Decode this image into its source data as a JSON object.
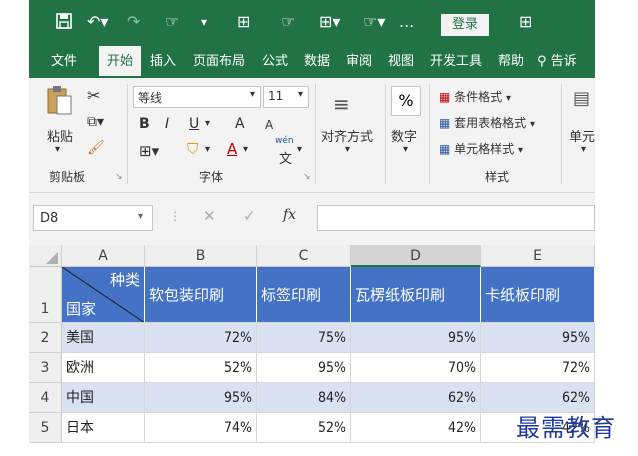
{
  "qat": {
    "save_icon": "save-icon",
    "undo_icon": "undo-icon",
    "redo_icon": "redo-icon",
    "more_label": "...",
    "login_label": "登录"
  },
  "tabs": [
    "文件",
    "开始",
    "插入",
    "页面布局",
    "公式",
    "数据",
    "审阅",
    "视图",
    "开发工具",
    "帮助",
    "告诉"
  ],
  "active_tab": "开始",
  "ribbon": {
    "clipboard": {
      "paste": "粘贴",
      "group": "剪贴板"
    },
    "font": {
      "name": "等线",
      "size": "11",
      "bold": "B",
      "italic": "I",
      "underline": "U",
      "grow": "A",
      "shrink": "A",
      "phonetic_top": "wén",
      "phonetic_bottom": "文",
      "color": "A",
      "group": "字体"
    },
    "align": {
      "label": "对齐方式"
    },
    "number": {
      "label": "数字",
      "symbol": "%"
    },
    "styles": {
      "conditional": "条件格式",
      "table": "套用表格格式",
      "cell": "单元格样式",
      "group": "样式"
    },
    "cells": {
      "label": "单元"
    }
  },
  "formula_bar": {
    "name_box": "D8",
    "fx": "fx",
    "value": ""
  },
  "columns": [
    "A",
    "B",
    "C",
    "D",
    "E"
  ],
  "selected_column": "D",
  "rows": [
    "1",
    "2",
    "3",
    "4",
    "5"
  ],
  "header": {
    "a_top": "种类",
    "a_bottom": "国家",
    "b": "软包装印刷",
    "c": "标签印刷",
    "d": "瓦楞纸板印刷",
    "e": "卡纸板印刷"
  },
  "table": [
    {
      "country": "美国",
      "b": "72%",
      "c": "75%",
      "d": "95%",
      "e": "95%"
    },
    {
      "country": "欧洲",
      "b": "52%",
      "c": "95%",
      "d": "70%",
      "e": "72%"
    },
    {
      "country": "中国",
      "b": "95%",
      "c": "84%",
      "d": "62%",
      "e": "62%"
    },
    {
      "country": "日本",
      "b": "74%",
      "c": "52%",
      "d": "42%",
      "e": "42%"
    }
  ],
  "watermark": "最需教育",
  "colors": {
    "excel_green": "#217346",
    "header_blue": "#4472c4",
    "band_blue": "#d9e1f2"
  }
}
